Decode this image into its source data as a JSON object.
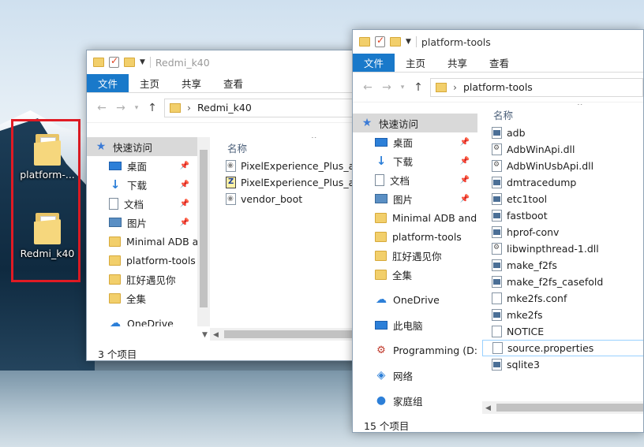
{
  "desktop": {
    "icons": [
      {
        "label": "platform-..."
      },
      {
        "label": "Redmi_k40"
      }
    ]
  },
  "left_window": {
    "title": "Redmi_k40",
    "ribbon": [
      "文件",
      "主页",
      "共享",
      "查看"
    ],
    "address": "Redmi_k40",
    "nav": [
      {
        "label": "快速访问",
        "icon": "star-icon",
        "pinned": false
      },
      {
        "label": "桌面",
        "icon": "desktop-icon",
        "pinned": true
      },
      {
        "label": "下载",
        "icon": "download-icon",
        "pinned": true
      },
      {
        "label": "文档",
        "icon": "document-icon",
        "pinned": true
      },
      {
        "label": "图片",
        "icon": "pictures-icon",
        "pinned": true
      },
      {
        "label": "Minimal ADB a",
        "icon": "folder-icon",
        "pinned": false
      },
      {
        "label": "platform-tools",
        "icon": "folder-icon",
        "pinned": false
      },
      {
        "label": "肛好遇见你",
        "icon": "folder-icon",
        "pinned": false
      },
      {
        "label": "全集",
        "icon": "folder-icon",
        "pinned": false
      },
      {
        "label": "OneDrive",
        "icon": "onedrive-icon",
        "pinned": false
      }
    ],
    "column_header": "名称",
    "files": [
      {
        "name": "PixelExperience_Plus_alio",
        "type": "img"
      },
      {
        "name": "PixelExperience_Plus_alio",
        "type": "zip"
      },
      {
        "name": "vendor_boot",
        "type": "img"
      }
    ],
    "status": "3 个项目"
  },
  "right_window": {
    "title": "platform-tools",
    "ribbon": [
      "文件",
      "主页",
      "共享",
      "查看"
    ],
    "address": "platform-tools",
    "nav": [
      {
        "label": "快速访问",
        "icon": "star-icon",
        "pinned": false
      },
      {
        "label": "桌面",
        "icon": "desktop-icon",
        "pinned": true
      },
      {
        "label": "下载",
        "icon": "download-icon",
        "pinned": true
      },
      {
        "label": "文档",
        "icon": "document-icon",
        "pinned": true
      },
      {
        "label": "图片",
        "icon": "pictures-icon",
        "pinned": true
      },
      {
        "label": "Minimal ADB and",
        "icon": "folder-icon",
        "pinned": false
      },
      {
        "label": "platform-tools",
        "icon": "folder-icon",
        "pinned": false
      },
      {
        "label": "肛好遇见你",
        "icon": "folder-icon",
        "pinned": false
      },
      {
        "label": "全集",
        "icon": "folder-icon",
        "pinned": false
      },
      {
        "label": "OneDrive",
        "icon": "onedrive-icon",
        "pinned": false
      },
      {
        "label": "此电脑",
        "icon": "this-pc-icon",
        "pinned": false
      },
      {
        "label": "Programming (D:)",
        "icon": "drive-icon",
        "pinned": false
      },
      {
        "label": "网络",
        "icon": "network-icon",
        "pinned": false
      },
      {
        "label": "家庭组",
        "icon": "homegroup-icon",
        "pinned": false
      }
    ],
    "column_header": "名称",
    "files": [
      {
        "name": "adb",
        "type": "exe"
      },
      {
        "name": "AdbWinApi.dll",
        "type": "dll"
      },
      {
        "name": "AdbWinUsbApi.dll",
        "type": "dll"
      },
      {
        "name": "dmtracedump",
        "type": "exe"
      },
      {
        "name": "etc1tool",
        "type": "exe"
      },
      {
        "name": "fastboot",
        "type": "exe"
      },
      {
        "name": "hprof-conv",
        "type": "exe"
      },
      {
        "name": "libwinpthread-1.dll",
        "type": "dll"
      },
      {
        "name": "make_f2fs",
        "type": "exe"
      },
      {
        "name": "make_f2fs_casefold",
        "type": "exe"
      },
      {
        "name": "mke2fs.conf",
        "type": "file"
      },
      {
        "name": "mke2fs",
        "type": "exe"
      },
      {
        "name": "NOTICE",
        "type": "file"
      },
      {
        "name": "source.properties",
        "type": "file"
      },
      {
        "name": "sqlite3",
        "type": "exe"
      }
    ],
    "status": "15 个项目"
  }
}
